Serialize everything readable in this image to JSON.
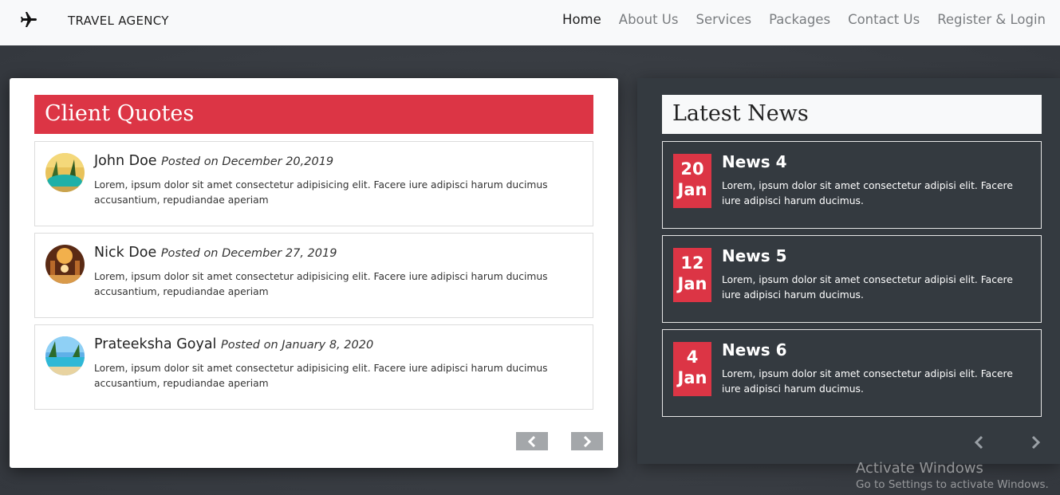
{
  "navbar": {
    "brand": "TRAVEL AGENCY",
    "links": [
      {
        "label": "Home",
        "active": true
      },
      {
        "label": "About Us"
      },
      {
        "label": "Services"
      },
      {
        "label": "Packages"
      },
      {
        "label": "Contact Us"
      },
      {
        "label": "Register & Login"
      }
    ]
  },
  "quotes": {
    "title": "Client Quotes",
    "items": [
      {
        "name": "John Doe",
        "posted": "Posted on December 20,2019",
        "text": "Lorem, ipsum dolor sit amet consectetur adipisicing elit. Facere iure adipisci harum ducimus accusantium, repudiandae aperiam"
      },
      {
        "name": "Nick Doe",
        "posted": "Posted on December 27, 2019",
        "text": "Lorem, ipsum dolor sit amet consectetur adipisicing elit. Facere iure adipisci harum ducimus accusantium, repudiandae aperiam"
      },
      {
        "name": "Prateeksha Goyal",
        "posted": "Posted on January 8, 2020",
        "text": "Lorem, ipsum dolor sit amet consectetur adipisicing elit. Facere iure adipisci harum ducimus accusantium, repudiandae aperiam"
      }
    ]
  },
  "news": {
    "title": "Latest News",
    "items": [
      {
        "day": "20",
        "month": "Jan",
        "title": "News 4",
        "text": "Lorem, ipsum dolor sit amet consectetur adipisi elit. Facere iure adipisci harum ducimus."
      },
      {
        "day": "12",
        "month": "Jan",
        "title": "News 5",
        "text": "Lorem, ipsum dolor sit amet consectetur adipisi elit. Facere iure adipisci harum ducimus."
      },
      {
        "day": "4",
        "month": "Jan",
        "title": "News 6",
        "text": "Lorem, ipsum dolor sit amet consectetur adipisi elit. Facere iure adipisci harum ducimus."
      }
    ]
  },
  "watermark": {
    "line1": "Activate Windows",
    "line2": "Go to Settings to activate Windows."
  },
  "colors": {
    "accent": "#dc3545",
    "dark": "#343a40",
    "light": "#f8f9fa"
  }
}
